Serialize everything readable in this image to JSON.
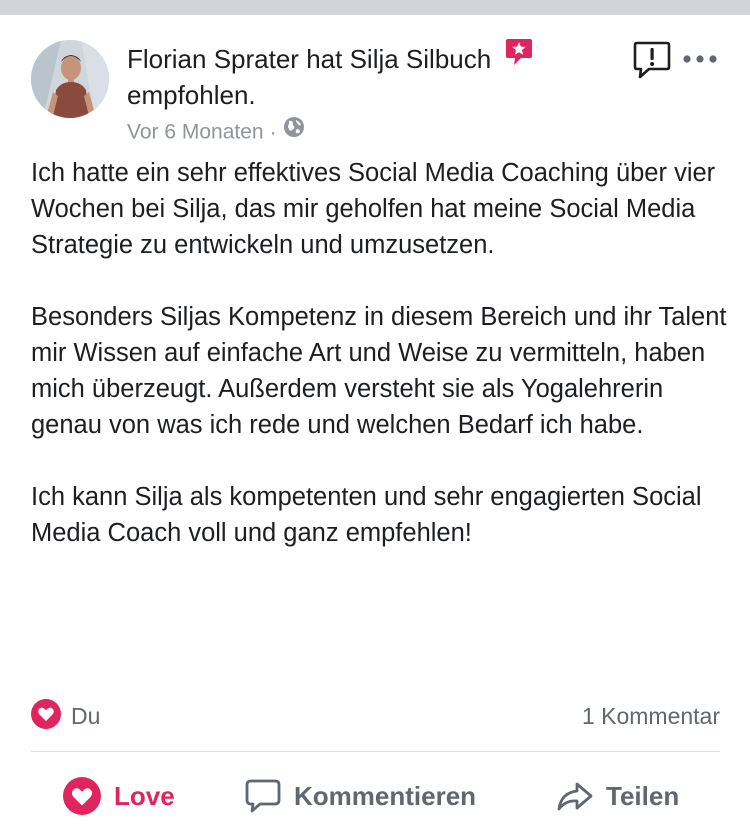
{
  "post": {
    "author": "Florian Sprater",
    "action_text": "hat Silja Silbuch",
    "action_text_2": "empfohlen.",
    "time": "Vor 6 Monaten",
    "separator": "·",
    "paragraphs": [
      "Ich hatte ein sehr effektives Social Media Coaching über vier Wochen bei Silja, das mir geholfen hat meine Social Media Strategie zu entwickeln und umzusetzen.",
      "Besonders Siljas Kompetenz in diesem Bereich und ihr Talent mir Wissen auf einfache Art und Weise zu vermitteln, haben mich überzeugt. Außerdem versteht sie als Yogalehrerin genau von was ich rede und welchen Bedarf ich habe.",
      "Ich kann Silja als kompetenten und sehr engagierten Social Media Coach voll und ganz empfehlen!"
    ]
  },
  "reactions": {
    "label": "Du",
    "comment_count": "1 Kommentar"
  },
  "actions": {
    "love": "Love",
    "comment": "Kommentieren",
    "share": "Teilen"
  },
  "colors": {
    "love": "#e0245e",
    "recommend_badge": "#e0245e",
    "text": "#1c1e21",
    "meta": "#90949c",
    "action": "#606770",
    "divider": "#dddfe2"
  },
  "icons": {
    "avatar": "avatar",
    "recommend": "recommendation-star-icon",
    "privacy": "globe-icon",
    "report": "report-icon",
    "more": "more-icon",
    "reaction": "heart-icon",
    "love": "heart-icon",
    "comment": "comment-bubble-icon",
    "share": "share-arrow-icon"
  }
}
